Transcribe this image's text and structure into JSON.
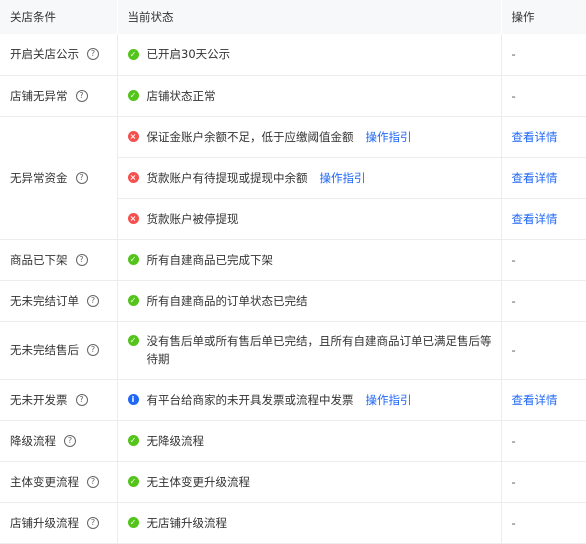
{
  "headers": {
    "condition": "关店条件",
    "status": "当前状态",
    "action": "操作"
  },
  "rows": [
    {
      "condition": "开启关店公示",
      "status": [
        {
          "icon": "ok",
          "text": "已开启30天公示",
          "link": "",
          "action": "-"
        }
      ]
    },
    {
      "condition": "店铺无异常",
      "status": [
        {
          "icon": "ok",
          "text": "店铺状态正常",
          "link": "",
          "action": "-"
        }
      ]
    },
    {
      "condition": "无异常资金",
      "status": [
        {
          "icon": "error",
          "text": "保证金账户余额不足，低于应缴阈值金额",
          "link": "操作指引",
          "action": "查看详情"
        },
        {
          "icon": "error",
          "text": "货款账户有待提现或提现中余额",
          "link": "操作指引",
          "action": "查看详情"
        },
        {
          "icon": "error",
          "text": "货款账户被停提现",
          "link": "",
          "action": "查看详情"
        }
      ]
    },
    {
      "condition": "商品已下架",
      "status": [
        {
          "icon": "ok",
          "text": "所有自建商品已完成下架",
          "link": "",
          "action": "-"
        }
      ]
    },
    {
      "condition": "无未完结订单",
      "status": [
        {
          "icon": "ok",
          "text": "所有自建商品的订单状态已完结",
          "link": "",
          "action": "-"
        }
      ]
    },
    {
      "condition": "无未完结售后",
      "status": [
        {
          "icon": "ok",
          "text": "没有售后单或所有售后单已完结，且所有自建商品订单已满足售后等待期",
          "link": "",
          "action": "-"
        }
      ]
    },
    {
      "condition": "无未开发票",
      "status": [
        {
          "icon": "info",
          "text": "有平台给商家的未开具发票或流程中发票",
          "link": "操作指引",
          "action": "查看详情"
        }
      ]
    },
    {
      "condition": "降级流程",
      "status": [
        {
          "icon": "ok",
          "text": "无降级流程",
          "link": "",
          "action": "-"
        }
      ]
    },
    {
      "condition": "主体变更流程",
      "status": [
        {
          "icon": "ok",
          "text": "无主体变更升级流程",
          "link": "",
          "action": "-"
        }
      ]
    },
    {
      "condition": "店铺升级流程",
      "status": [
        {
          "icon": "ok",
          "text": "无店铺升级流程",
          "link": "",
          "action": "-"
        }
      ]
    }
  ],
  "colors": {
    "ok": "#52c41a",
    "error": "#f5504e",
    "info": "#1f67f5",
    "link": "#1f67f5"
  }
}
